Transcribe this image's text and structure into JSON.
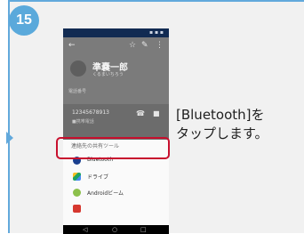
{
  "step": {
    "number": "15"
  },
  "instruction": {
    "line1": "[Bluetooth]を",
    "line2": "タップします。"
  },
  "phone": {
    "header": {
      "back_icon": "arrow-left-icon",
      "star_icon": "star-icon",
      "edit_icon": "pencil-icon",
      "menu_icon": "more-vert-icon",
      "contact_name": "準嚢一郎",
      "contact_kana": "くるまいちろう"
    },
    "phone_section_label": "電話番号",
    "phone_number": "12345678913",
    "phone_type": "■携帯電話",
    "share_sheet": {
      "title": "連絡先の共有ツール",
      "items": [
        {
          "label": "Bluetooth",
          "icon": "bluetooth-icon"
        },
        {
          "label": "ドライブ",
          "icon": "drive-icon"
        },
        {
          "label": "Androidビーム",
          "icon": "android-beam-icon"
        },
        {
          "label": "",
          "icon": "app-icon"
        }
      ]
    },
    "nav": {
      "back": "◁",
      "home": "○",
      "recent": "□"
    }
  },
  "colors": {
    "accent": "#5aa9db",
    "highlight": "#c8102e",
    "statusbar": "#122b52"
  }
}
